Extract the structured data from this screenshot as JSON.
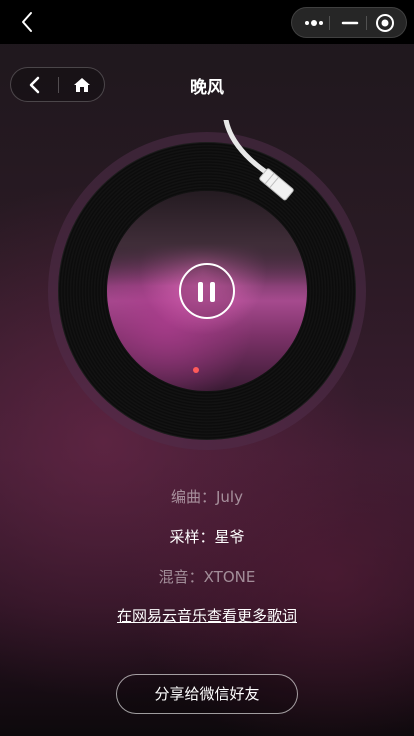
{
  "header": {
    "title": "晚风"
  },
  "icons": {
    "system_back": "chevron-left-icon",
    "more": "more-dots-icon",
    "minimize": "minimize-icon",
    "close": "target-circle-icon",
    "nav_back": "chevron-left-icon",
    "nav_home": "home-icon",
    "pause": "pause-icon"
  },
  "player": {
    "state": "playing"
  },
  "credits": {
    "arranger": "编曲：July",
    "sampling": "采样：星爷",
    "mixing": "混音：XTONE"
  },
  "links": {
    "more_lyrics": "在网易云音乐查看更多歌词"
  },
  "actions": {
    "share": "分享给微信好友"
  },
  "colors": {
    "accent_pink": "#c2509f",
    "background_top": "#1d171c",
    "background_mid": "#3b1c30"
  }
}
